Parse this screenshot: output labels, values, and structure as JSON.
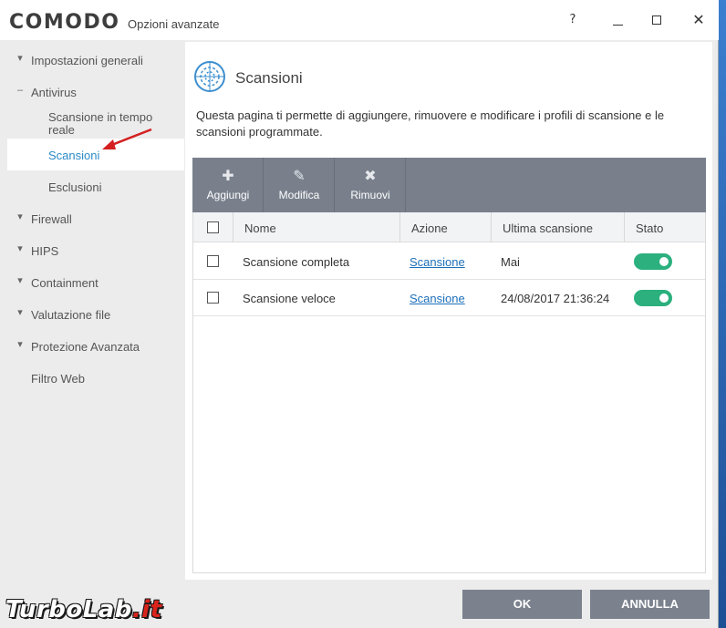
{
  "window": {
    "logo": "COMODO",
    "title": "Opzioni avanzate",
    "help": "?",
    "close": "✕"
  },
  "sidebar": {
    "items": [
      {
        "label": "Impostazioni generali",
        "chevron": "▾"
      },
      {
        "label": "Antivirus",
        "chevron": "–"
      },
      {
        "label": "Scansione in tempo reale"
      },
      {
        "label": "Scansioni"
      },
      {
        "label": "Esclusioni"
      },
      {
        "label": "Firewall",
        "chevron": "▾"
      },
      {
        "label": "HIPS",
        "chevron": "▾"
      },
      {
        "label": "Containment",
        "chevron": "▾"
      },
      {
        "label": "Valutazione file",
        "chevron": "▾"
      },
      {
        "label": "Protezione Avanzata",
        "chevron": "▾"
      },
      {
        "label": "Filtro Web"
      }
    ],
    "active": "Scansioni"
  },
  "main": {
    "title": "Scansioni",
    "description": "Questa pagina ti permette di aggiungere, rimuovere e modificare i profili di scansione e le scansioni programmate.",
    "toolbar": [
      {
        "label": "Aggiungi",
        "icon": "plus-icon",
        "glyph": "✚"
      },
      {
        "label": "Modifica",
        "icon": "pencil-icon",
        "glyph": "✎"
      },
      {
        "label": "Rimuovi",
        "icon": "remove-icon",
        "glyph": "✖"
      }
    ],
    "table": {
      "headers": [
        "Nome",
        "Azione",
        "Ultima scansione",
        "Stato"
      ],
      "rows": [
        {
          "name": "Scansione completa",
          "action": "Scansione",
          "last": "Mai",
          "enabled": true
        },
        {
          "name": "Scansione veloce",
          "action": "Scansione",
          "last": "24/08/2017 21:36:24",
          "enabled": true
        }
      ]
    }
  },
  "footer": {
    "ok": "OK",
    "cancel": "ANNULLA"
  },
  "watermark": {
    "text": "TurboLab",
    "suffix": ".it"
  },
  "colors": {
    "toolbar": "#79808c",
    "toggle_on": "#2bb07e",
    "link": "#1d6fb8",
    "active_item": "#2b8ac9",
    "annotation_arrow": "#d42020"
  }
}
